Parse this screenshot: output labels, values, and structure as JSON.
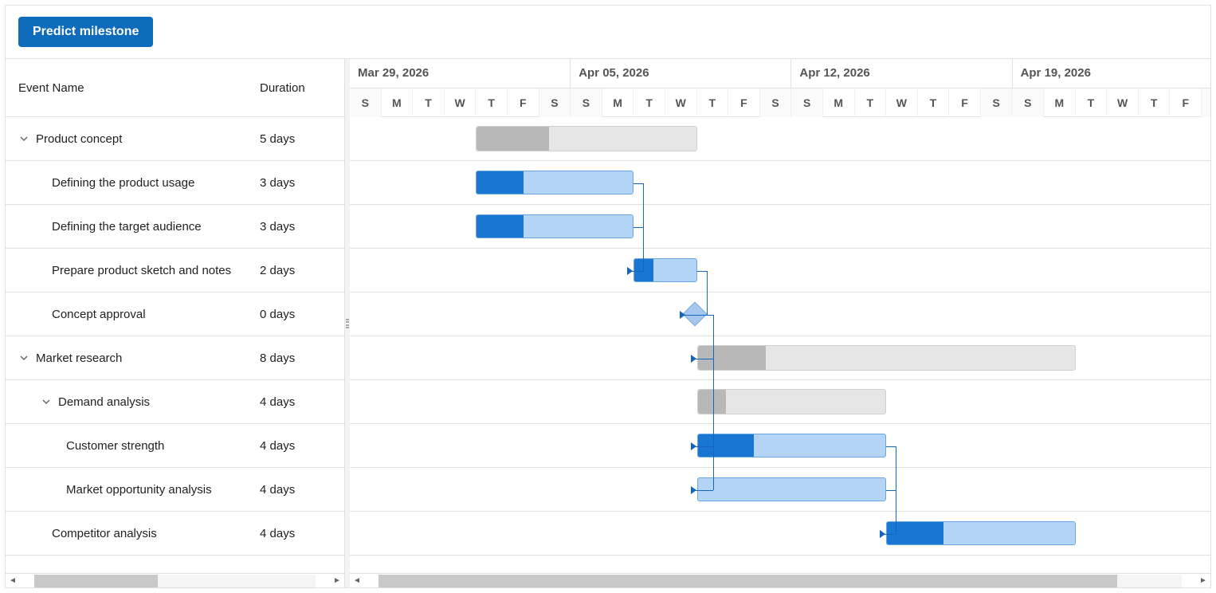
{
  "toolbar": {
    "predict_label": "Predict milestone"
  },
  "grid": {
    "columns": {
      "name": "Event Name",
      "duration": "Duration"
    }
  },
  "timeline": {
    "dayWidth": 39.6,
    "weeks": [
      "Mar 29, 2026",
      "Apr 05, 2026",
      "Apr 12, 2026",
      "Apr 19, 2026"
    ],
    "dayLabels": [
      "S",
      "M",
      "T",
      "W",
      "T",
      "F",
      "S"
    ],
    "weekendIdx": [
      0,
      6
    ]
  },
  "tasks": [
    {
      "name": "Product concept",
      "duration": "5 days",
      "indent": 0,
      "hasChildren": true,
      "type": "summary",
      "startDay": 4,
      "span": 7,
      "progress": 33
    },
    {
      "name": "Defining the product usage",
      "duration": "3 days",
      "indent": 1,
      "hasChildren": false,
      "type": "task",
      "startDay": 4,
      "span": 5,
      "progress": 30
    },
    {
      "name": "Defining the target audience",
      "duration": "3 days",
      "indent": 1,
      "hasChildren": false,
      "type": "task",
      "startDay": 4,
      "span": 5,
      "progress": 30
    },
    {
      "name": "Prepare product sketch and notes",
      "duration": "2 days",
      "indent": 1,
      "hasChildren": false,
      "type": "task",
      "startDay": 9,
      "span": 2,
      "progress": 30
    },
    {
      "name": "Concept approval",
      "duration": "0 days",
      "indent": 1,
      "hasChildren": false,
      "type": "milestone",
      "startDay": 10.65,
      "span": 0,
      "progress": 0
    },
    {
      "name": "Market research",
      "duration": "8 days",
      "indent": 0,
      "hasChildren": true,
      "type": "summary",
      "startDay": 11,
      "span": 12,
      "progress": 18
    },
    {
      "name": "Demand analysis",
      "duration": "4 days",
      "indent": 1,
      "hasChildren": true,
      "type": "summary",
      "startDay": 11,
      "span": 6,
      "progress": 15
    },
    {
      "name": "Customer strength",
      "duration": "4 days",
      "indent": 2,
      "hasChildren": false,
      "type": "task",
      "startDay": 11,
      "span": 6,
      "progress": 30
    },
    {
      "name": "Market opportunity analysis",
      "duration": "4 days",
      "indent": 2,
      "hasChildren": false,
      "type": "task",
      "startDay": 11,
      "span": 6,
      "progress": 0
    },
    {
      "name": "Competitor analysis",
      "duration": "4 days",
      "indent": 1,
      "hasChildren": false,
      "type": "task",
      "startDay": 17,
      "span": 6,
      "progress": 30
    }
  ],
  "links": [
    {
      "from": 1,
      "to": 3
    },
    {
      "from": 2,
      "to": 3
    },
    {
      "from": 3,
      "to": 4
    },
    {
      "from": 4,
      "to": 5
    },
    {
      "from": 4,
      "to": 7
    },
    {
      "from": 4,
      "to": 8
    },
    {
      "from": 7,
      "to": 9
    },
    {
      "from": 8,
      "to": 9
    }
  ]
}
